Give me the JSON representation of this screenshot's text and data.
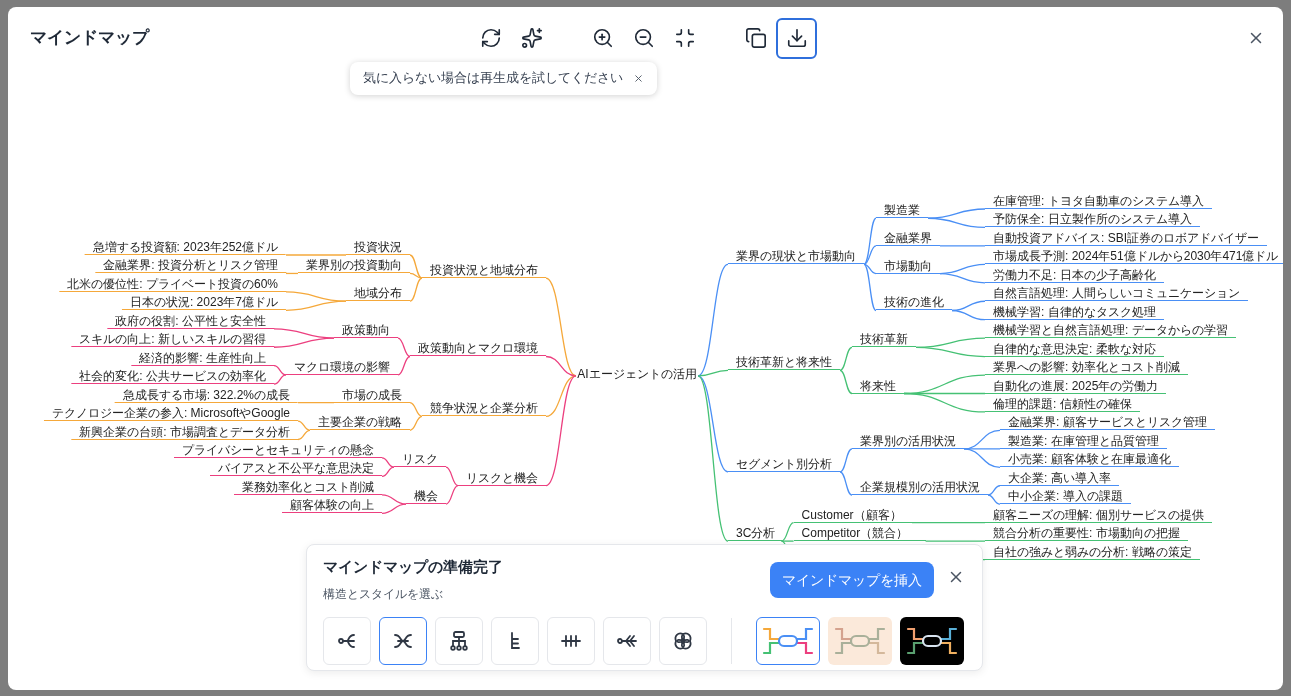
{
  "window": {
    "title": "マインドマップ"
  },
  "toolbar": [
    {
      "kind": "regenerate",
      "selected": false
    },
    {
      "kind": "magic",
      "selected": false
    },
    {
      "kind": "zoom-in",
      "selected": false
    },
    {
      "kind": "zoom-out",
      "selected": false
    },
    {
      "kind": "fit",
      "selected": false
    },
    {
      "kind": "copy",
      "selected": false
    },
    {
      "kind": "download",
      "selected": true
    }
  ],
  "hint": {
    "text": "気に入らない場合は再生成を試してください"
  },
  "mindmap": {
    "root": "AIエージェントの活用",
    "left": [
      {
        "label": "投資状況と地域分布",
        "color": "#f5a83a",
        "children": [
          {
            "label": "投資状況",
            "children": [
              {
                "label": "急増する投資額: 2023年252億ドル"
              }
            ]
          },
          {
            "label": "業界別の投資動向",
            "children": [
              {
                "label": "金融業界: 投資分析とリスク管理"
              }
            ]
          },
          {
            "label": "地域分布",
            "children": [
              {
                "label": "北米の優位性: プライベート投資の60%"
              },
              {
                "label": "日本の状況: 2023年7億ドル"
              }
            ]
          }
        ]
      },
      {
        "label": "政策動向とマクロ環境",
        "color": "#ec3f7f",
        "children": [
          {
            "label": "政策動向",
            "children": [
              {
                "label": "政府の役割: 公平性と安全性"
              },
              {
                "label": "スキルの向上: 新しいスキルの習得"
              }
            ]
          },
          {
            "label": "マクロ環境の影響",
            "children": [
              {
                "label": "経済的影響: 生産性向上"
              },
              {
                "label": "社会的変化: 公共サービスの効率化"
              }
            ]
          }
        ]
      },
      {
        "label": "競争状況と企業分析",
        "color": "#f5a83a",
        "children": [
          {
            "label": "市場の成長",
            "children": [
              {
                "label": "急成長する市場: 322.2%の成長"
              }
            ]
          },
          {
            "label": "主要企業の戦略",
            "children": [
              {
                "label": "テクノロジー企業の参入: MicrosoftやGoogle"
              },
              {
                "label": "新興企業の台頭: 市場調査とデータ分析"
              }
            ]
          }
        ]
      },
      {
        "label": "リスクと機会",
        "color": "#ec3f7f",
        "children": [
          {
            "label": "リスク",
            "children": [
              {
                "label": "プライバシーとセキュリティの懸念"
              },
              {
                "label": "バイアスと不公平な意思決定"
              }
            ]
          },
          {
            "label": "機会",
            "children": [
              {
                "label": "業務効率化とコスト削減"
              },
              {
                "label": "顧客体験の向上"
              }
            ]
          }
        ]
      }
    ],
    "right": [
      {
        "label": "業界の現状と市場動向",
        "color": "#4a8ff5",
        "children": [
          {
            "label": "製造業",
            "children": [
              {
                "label": "在庫管理: トヨタ自動車のシステム導入"
              },
              {
                "label": "予防保全: 日立製作所のシステム導入"
              }
            ]
          },
          {
            "label": "金融業界",
            "children": [
              {
                "label": "自動投資アドバイス: SBI証券のロボアドバイザー"
              }
            ]
          },
          {
            "label": "市場動向",
            "children": [
              {
                "label": "市場成長予測: 2024年51億ドルから2030年471億ドル"
              },
              {
                "label": "労働力不足: 日本の少子高齢化"
              }
            ]
          },
          {
            "label": "技術の進化",
            "children": [
              {
                "label": "自然言語処理: 人間らしいコミュニケーション"
              },
              {
                "label": "機械学習: 自律的なタスク処理"
              }
            ]
          }
        ]
      },
      {
        "label": "技術革新と将来性",
        "color": "#45c174",
        "children": [
          {
            "label": "技術革新",
            "children": [
              {
                "label": "機械学習と自然言語処理: データからの学習"
              },
              {
                "label": "自律的な意思決定: 柔軟な対応"
              }
            ]
          },
          {
            "label": "将来性",
            "children": [
              {
                "label": "業界への影響: 効率化とコスト削減"
              },
              {
                "label": "自動化の進展: 2025年の労働力"
              },
              {
                "label": "倫理的課題: 信頼性の確保"
              }
            ]
          }
        ]
      },
      {
        "label": "セグメント別分析",
        "color": "#4a8ff5",
        "children": [
          {
            "label": "業界別の活用状況",
            "children": [
              {
                "label": "金融業界: 顧客サービスとリスク管理"
              },
              {
                "label": "製造業: 在庫管理と品質管理"
              },
              {
                "label": "小売業: 顧客体験と在庫最適化"
              }
            ]
          },
          {
            "label": "企業規模別の活用状況",
            "children": [
              {
                "label": "大企業: 高い導入率"
              },
              {
                "label": "中小企業: 導入の課題"
              }
            ]
          }
        ]
      },
      {
        "label": "3C分析",
        "color": "#45c174",
        "children": [
          {
            "label": "Customer（顧客）",
            "children": [
              {
                "label": "顧客ニーズの理解: 個別サービスの提供"
              }
            ]
          },
          {
            "label": "Competitor（競合）",
            "children": [
              {
                "label": "競合分析の重要性: 市場動向の把握"
              }
            ]
          },
          {
            "children": [
              {
                "label": "自社の強みと弱みの分析: 戦略の策定"
              }
            ]
          }
        ]
      }
    ]
  },
  "panel": {
    "title": "マインドマップの準備完了",
    "subtitle": "構造とスタイルを選ぶ",
    "insert_button": "マインドマップを挿入",
    "structures": [
      {
        "kind": "right",
        "selected": false
      },
      {
        "kind": "both",
        "selected": true
      },
      {
        "kind": "org",
        "selected": false
      },
      {
        "kind": "tree",
        "selected": false
      },
      {
        "kind": "timeline",
        "selected": false
      },
      {
        "kind": "fishbone",
        "selected": false
      },
      {
        "kind": "flower",
        "selected": false
      }
    ],
    "styles": [
      {
        "kind": "colorful",
        "selected": true
      },
      {
        "kind": "beige",
        "selected": false
      },
      {
        "kind": "dark",
        "selected": false
      }
    ]
  }
}
